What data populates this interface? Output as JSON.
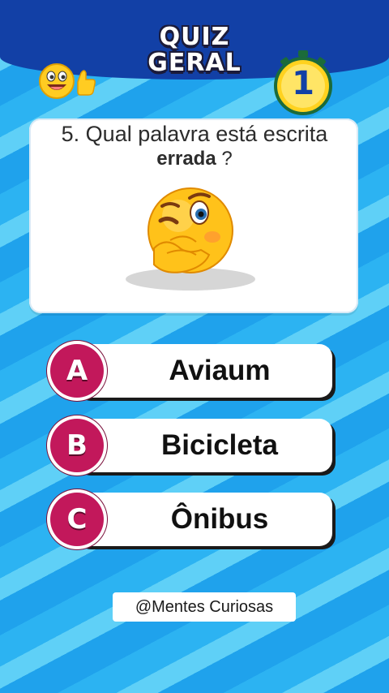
{
  "header": {
    "title_line1": "QUIZ",
    "title_line2": "GERAL",
    "timer_value": "1",
    "icons": [
      "smiley-thumbs-up-icon",
      "stopwatch-icon"
    ]
  },
  "question": {
    "line1": "5. Qual palavra está escrita",
    "emphasis": "errada",
    "suffix": " ?",
    "illustration": "winking-thinking-emoji"
  },
  "answers": [
    {
      "letter": "A",
      "text": "Aviaum"
    },
    {
      "letter": "B",
      "text": "Bicicleta"
    },
    {
      "letter": "C",
      "text": "Ônibus"
    }
  ],
  "credit": "@Mentes Curiosas",
  "colors": {
    "header": "#1240a6",
    "badge": "#c2185b",
    "background": "#2aa9ef"
  }
}
